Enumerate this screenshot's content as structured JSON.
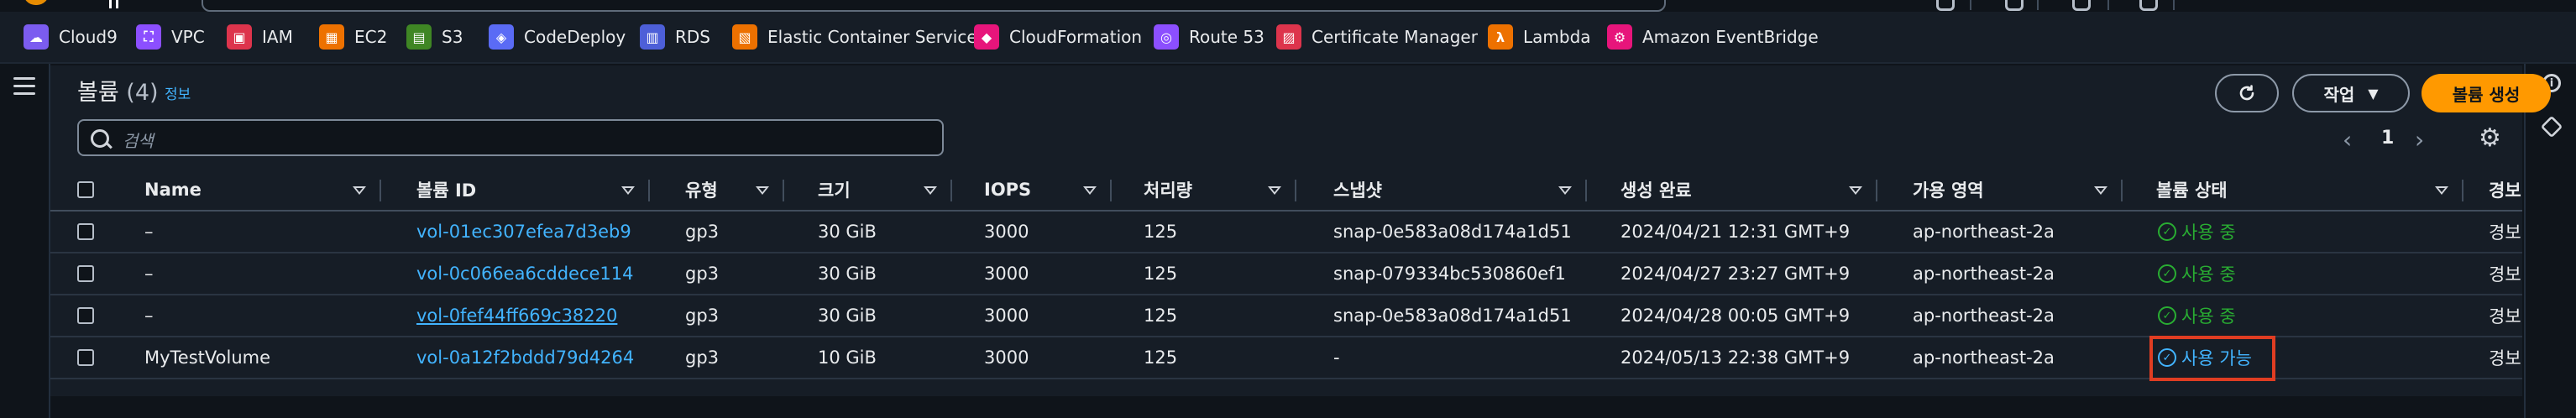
{
  "favorites": [
    {
      "label": "Cloud9",
      "icon": "cloud9-icon",
      "color": "#7b5cf0"
    },
    {
      "label": "VPC",
      "icon": "vpc-icon",
      "color": "#8c4fff"
    },
    {
      "label": "IAM",
      "icon": "iam-icon",
      "color": "#dd344c"
    },
    {
      "label": "EC2",
      "icon": "ec2-icon",
      "color": "#ed7100"
    },
    {
      "label": "S3",
      "icon": "s3-icon",
      "color": "#3f8624"
    },
    {
      "label": "CodeDeploy",
      "icon": "codedeploy-icon",
      "color": "#5a6bf5"
    },
    {
      "label": "RDS",
      "icon": "rds-icon",
      "color": "#4d5fd8"
    },
    {
      "label": "Elastic Container Service",
      "icon": "ecs-icon",
      "color": "#ed7100"
    },
    {
      "label": "CloudFormation",
      "icon": "cloudformation-icon",
      "color": "#e7157b"
    },
    {
      "label": "Route 53",
      "icon": "route53-icon",
      "color": "#8c4fff"
    },
    {
      "label": "Certificate Manager",
      "icon": "certificate-manager-icon",
      "color": "#dd344c"
    },
    {
      "label": "Lambda",
      "icon": "lambda-icon",
      "color": "#ed7100"
    },
    {
      "label": "Amazon EventBridge",
      "icon": "eventbridge-icon",
      "color": "#e7157b"
    }
  ],
  "panel": {
    "title": "볼륨",
    "count": "(4)",
    "info": "정보",
    "refresh_icon": "refresh-icon",
    "actions_label": "작업",
    "create_label": "볼륨 생성",
    "search_placeholder": "검색",
    "page": "1"
  },
  "table": {
    "columns": [
      "Name",
      "볼륨 ID",
      "유형",
      "크기",
      "IOPS",
      "처리량",
      "스냅샷",
      "생성 완료",
      "가용 영역",
      "볼륨 상태",
      "경보"
    ],
    "rows": [
      {
        "name": "–",
        "volume_id": "vol-01ec307efea7d3eb9",
        "type": "gp3",
        "size": "30 GiB",
        "iops": "3000",
        "throughput": "125",
        "snapshot": "snap-0e583a08d174a1d51",
        "created": "2024/04/21 12:31 GMT+9",
        "az": "ap-northeast-2a",
        "state": "사용 중",
        "state_kind": "in-use",
        "alarm": "경보"
      },
      {
        "name": "–",
        "volume_id": "vol-0c066ea6cddece114",
        "type": "gp3",
        "size": "30 GiB",
        "iops": "3000",
        "throughput": "125",
        "snapshot": "snap-079334bc530860ef1",
        "created": "2024/04/27 23:27 GMT+9",
        "az": "ap-northeast-2a",
        "state": "사용 중",
        "state_kind": "in-use",
        "alarm": "경보"
      },
      {
        "name": "–",
        "volume_id": "vol-0fef44ff669c38220",
        "type": "gp3",
        "size": "30 GiB",
        "iops": "3000",
        "throughput": "125",
        "snapshot": "snap-0e583a08d174a1d51",
        "created": "2024/04/28 00:05 GMT+9",
        "az": "ap-northeast-2a",
        "state": "사용 중",
        "state_kind": "in-use",
        "alarm": "경보"
      },
      {
        "name": "MyTestVolume",
        "volume_id": "vol-0a12f2bddd79d4264",
        "type": "gp3",
        "size": "10 GiB",
        "iops": "3000",
        "throughput": "125",
        "snapshot": "-",
        "created": "2024/05/13 22:38 GMT+9",
        "az": "ap-northeast-2a",
        "state": "사용 가능",
        "state_kind": "available",
        "alarm": "경보"
      }
    ]
  },
  "colors": {
    "accent": "#ff9900",
    "link": "#42b4ff",
    "in_use": "#29ad32",
    "highlight": "#e03d22"
  }
}
